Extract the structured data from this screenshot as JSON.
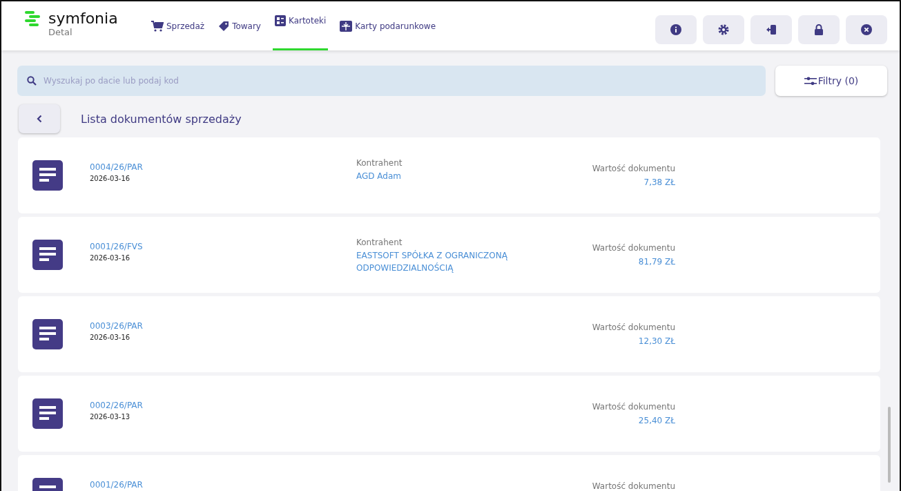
{
  "app": {
    "name": "symfonia",
    "subtitle": "Detal"
  },
  "tabs": [
    {
      "label": "Sprzedaż",
      "kind": "cart",
      "selected": false
    },
    {
      "label": "Towary",
      "kind": "tag",
      "selected": false
    },
    {
      "label": "Kartoteki",
      "kind": "cards",
      "selected": true
    },
    {
      "label": "Karty podarunkowe",
      "kind": "gift",
      "selected": false
    }
  ],
  "toolbar": [
    {
      "kind": "info"
    },
    {
      "kind": "settings"
    },
    {
      "kind": "logout"
    },
    {
      "kind": "lock"
    },
    {
      "kind": "close"
    }
  ],
  "search": {
    "placeholder": "Wyszukaj po dacie lub podaj kod"
  },
  "filter_button": "Filtry (0)",
  "title": "Lista dokumentów sprzedaży",
  "documents": [
    {
      "number": "0004/26/PAR",
      "date": "2026-03-16",
      "contractor_label": "Kontrahent",
      "contractor": "AGD Adam",
      "value_label": "Wartość dokumentu",
      "value": "7,38 ZŁ"
    },
    {
      "number": "0001/26/FVS",
      "date": "2026-03-16",
      "contractor_label": "Kontrahent",
      "contractor": "EASTSOFT SPÓŁKA Z OGRANICZONĄ ODPOWIEDZIALNOŚCIĄ",
      "value_label": "Wartość dokumentu",
      "value": "81,79 ZŁ"
    },
    {
      "number": "0003/26/PAR",
      "date": "2026-03-16",
      "value_label": "Wartość dokumentu",
      "value": "12,30 ZŁ"
    },
    {
      "number": "0002/26/PAR",
      "date": "2026-03-13",
      "value_label": "Wartość dokumentu",
      "value": "25,40 ZŁ"
    },
    {
      "number": "0001/26/PAR",
      "value_label": "Wartość dokumentu"
    }
  ]
}
